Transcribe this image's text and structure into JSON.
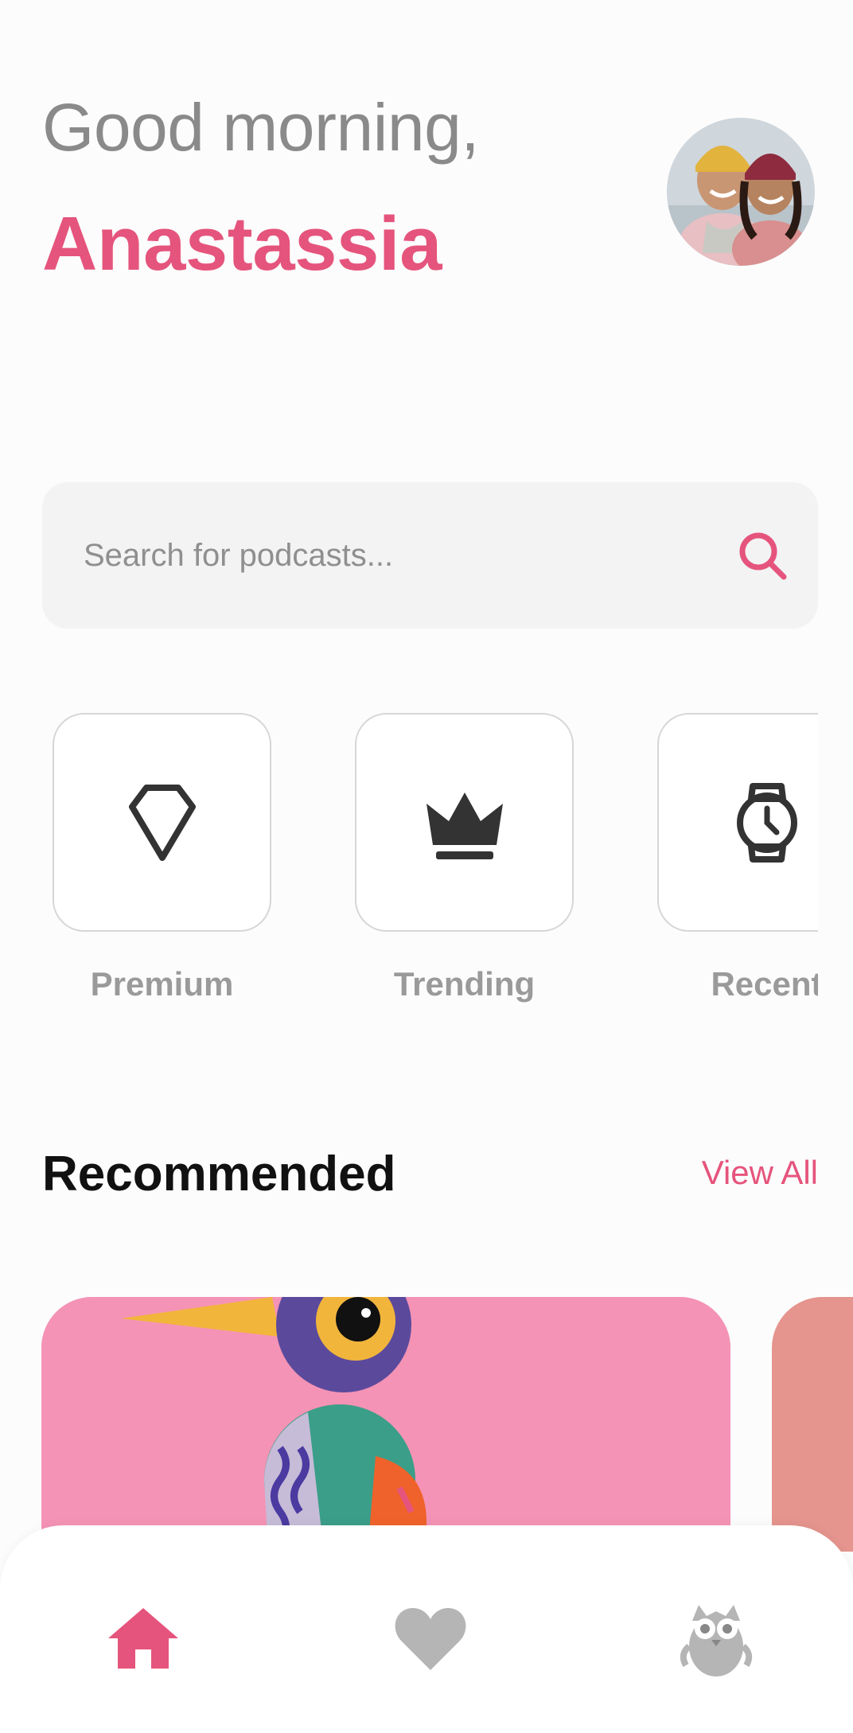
{
  "header": {
    "greeting": "Good morning,",
    "name": "Anastassia"
  },
  "search": {
    "placeholder": "Search for podcasts...",
    "icon": "search-icon"
  },
  "categories": [
    {
      "label": "Premium",
      "icon": "diamond-icon"
    },
    {
      "label": "Trending",
      "icon": "crown-icon"
    },
    {
      "label": "Recent",
      "icon": "watch-icon"
    }
  ],
  "recommended": {
    "title": "Recommended",
    "view_all": "View All"
  },
  "bottom_nav": [
    {
      "name": "home",
      "icon": "home-icon",
      "active": true
    },
    {
      "name": "favorites",
      "icon": "heart-icon",
      "active": false
    },
    {
      "name": "profile",
      "icon": "owl-icon",
      "active": false
    }
  ],
  "colors": {
    "accent": "#e5547c",
    "muted": "#9a9a9a",
    "inactive_icon": "#b5b5b5",
    "card_pink": "#f493b5",
    "card_coral": "#e5948e"
  }
}
